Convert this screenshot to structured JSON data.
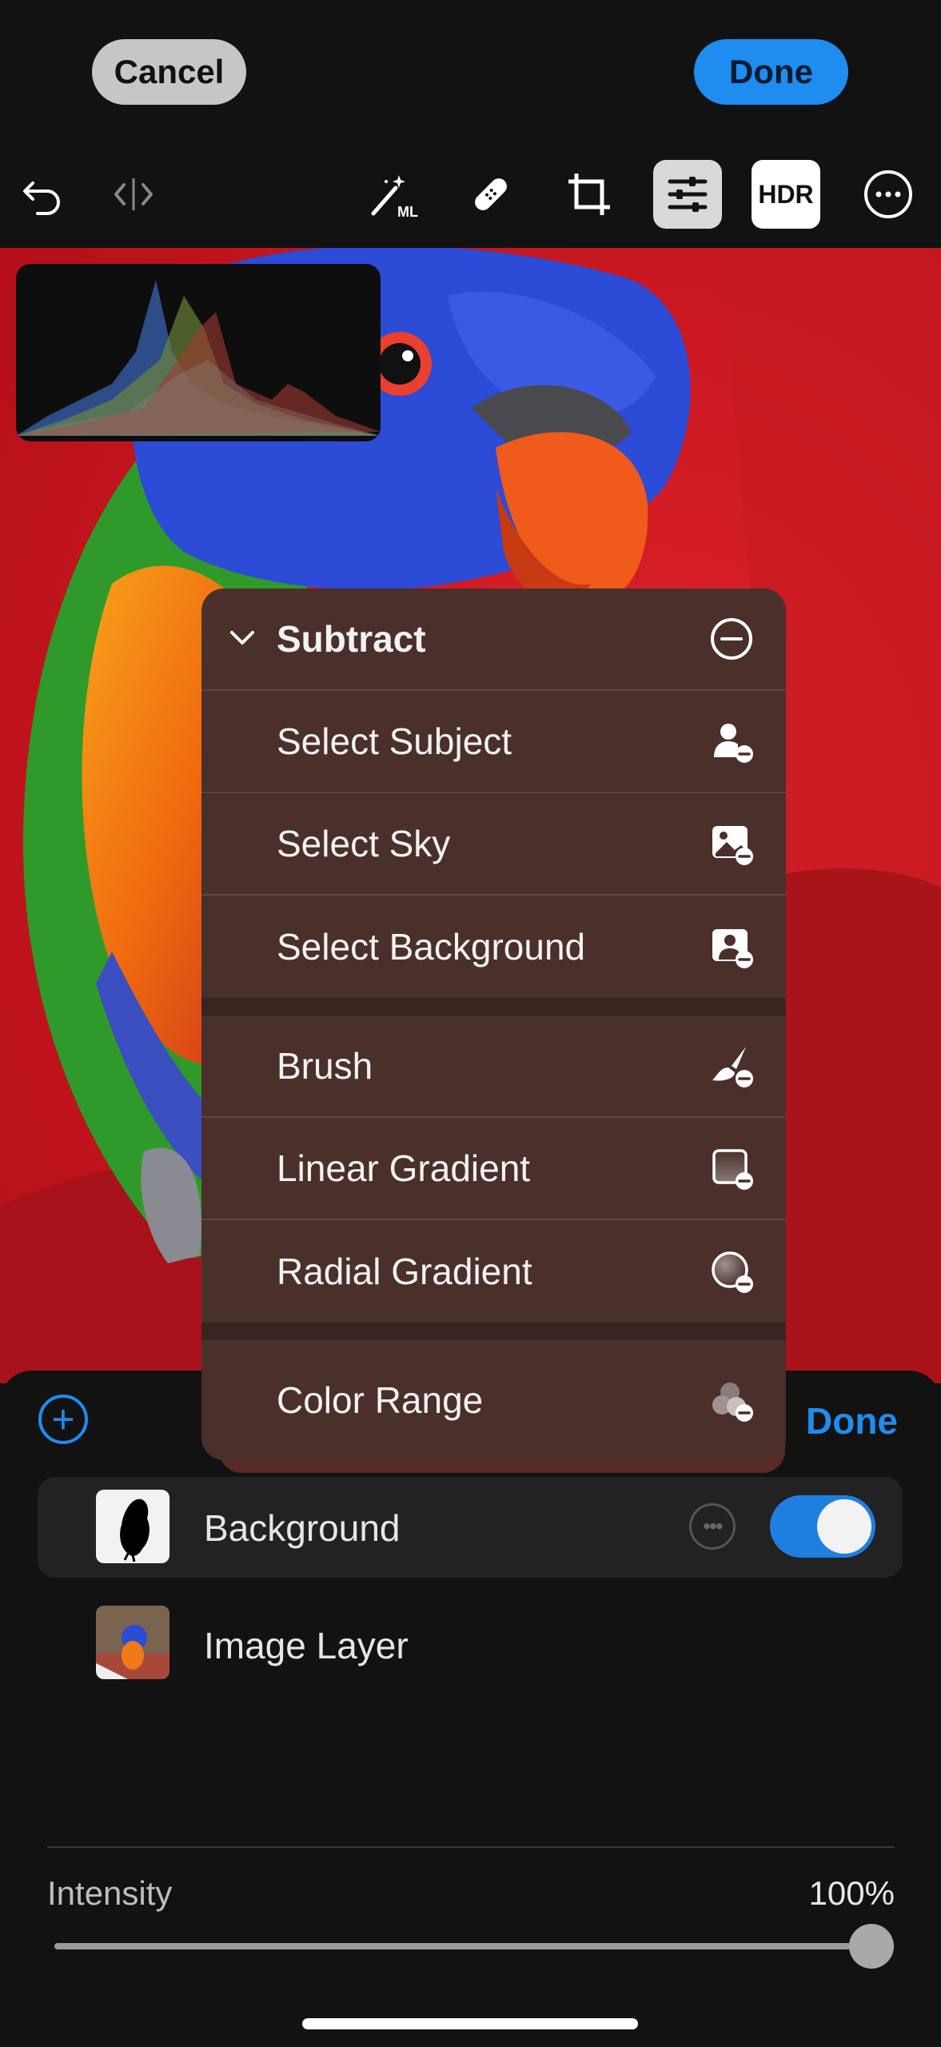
{
  "topbar": {
    "cancel_label": "Cancel",
    "done_label": "Done"
  },
  "toolbar": {
    "items": [
      "undo-icon",
      "compare-icon",
      "auto-ml-icon",
      "heal-icon",
      "crop-icon",
      "adjust-icon",
      "hdr-toggle",
      "more-icon"
    ],
    "hdr_label": "HDR",
    "ml_label": "ML"
  },
  "menu": {
    "header": "Subtract",
    "groups": [
      [
        "Select Subject",
        "Select Sky",
        "Select Background"
      ],
      [
        "Brush",
        "Linear Gradient",
        "Radial Gradient"
      ],
      [
        "Color Range"
      ]
    ],
    "item_icons": [
      "subject-subtract-icon",
      "sky-subtract-icon",
      "background-subtract-icon",
      "brush-subtract-icon",
      "linear-gradient-subtract-icon",
      "radial-gradient-subtract-icon",
      "color-range-subtract-icon"
    ]
  },
  "panel": {
    "done_label": "Done",
    "layers": [
      {
        "name": "Background",
        "visible": true
      },
      {
        "name": "Image Layer"
      }
    ],
    "intensity_label": "Intensity",
    "intensity_value": "100%",
    "intensity_fraction": 1.0
  },
  "colors": {
    "accent": "#1f8cf0",
    "menu_bg": "#4b2f2b",
    "background": "#121212"
  }
}
